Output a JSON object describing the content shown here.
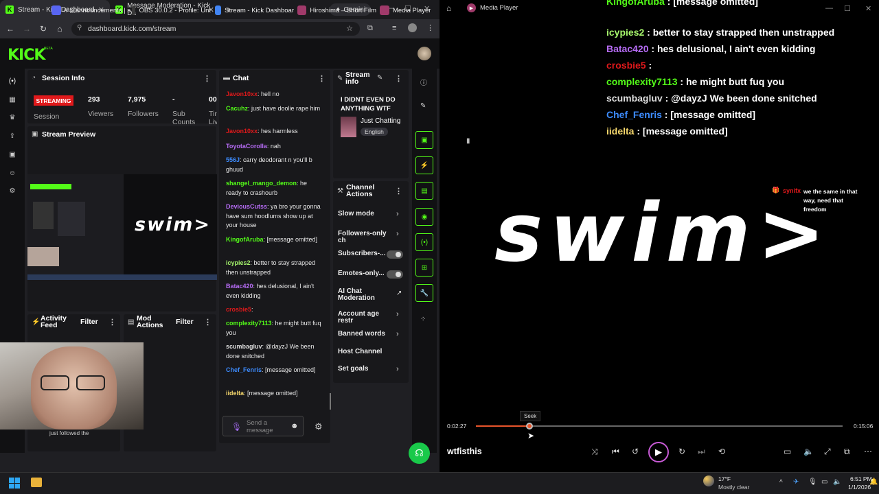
{
  "browser": {
    "tabs": [
      {
        "label": "Stream - Kick Dashboard"
      },
      {
        "label": "Message Moderation - Kick Da"
      }
    ],
    "gemini_label": "Gemini",
    "url": "dashboard.kick.com/stream"
  },
  "kick": {
    "logo": "KICK",
    "beta": "BETA",
    "session": {
      "title": "Session Info",
      "status": "STREAMING",
      "session_label": "Session",
      "viewers_value": "293",
      "viewers_label": "Viewers",
      "followers_value": "7,975",
      "followers_label": "Followers",
      "subs_value": "-",
      "subs_label": "Sub Counts",
      "fourth_value": "00",
      "fourth_label": "Tin Liv"
    },
    "preview": {
      "title": "Stream Preview",
      "overlay": "swim>"
    },
    "activity": {
      "title": "Activity Feed",
      "filter": "Filter",
      "item": "just followed the"
    },
    "mod": {
      "title": "Mod Actions",
      "filter": "Filter"
    },
    "chat": {
      "title": "Chat",
      "messages": [
        {
          "user": "Javon10xx",
          "color": "#e0191b",
          "text": ": hell no"
        },
        {
          "user": "Cacuhz",
          "color": "#53fc18",
          "text": ": just have doolie rape him"
        },
        {
          "user": "Javon10xx",
          "color": "#e0191b",
          "text": ": hes harmless"
        },
        {
          "user": "ToyotaCorolla",
          "color": "#b66cf5",
          "text": ": nah"
        },
        {
          "user": "556J",
          "color": "#3d8cff",
          "text": ": carry deodorant n you'll b ghuud"
        },
        {
          "user": "shangel_mango_demon",
          "color": "#53fc18",
          "text": ": he ready to crashourb"
        },
        {
          "user": "DeviousCutss",
          "color": "#b66cf5",
          "text": ": ya bro your gonna have sum hoodlums show up at your house"
        },
        {
          "user": "KingofAruba",
          "color": "#53fc18",
          "text": ": [message omitted]"
        },
        {
          "user": "icypies2",
          "color": "#a6f56c",
          "text": ": better to stay strapped then unstrapped"
        },
        {
          "user": "Batac420",
          "color": "#b66cf5",
          "text": ": hes delusional, I ain't even kidding"
        },
        {
          "user": "crosbie5",
          "color": "#e0191b",
          "text": ":"
        },
        {
          "user": "complexity7113",
          "color": "#53fc18",
          "text": ": he might butt fuq you"
        },
        {
          "user": "scumbagluv",
          "color": "#dddddd",
          "text": ": @dayzJ We been done snitched"
        },
        {
          "user": "Chef_Fenris",
          "color": "#3d8cff",
          "text": ": [message omitted]"
        },
        {
          "user": "iidelta",
          "color": "#f5d76c",
          "text": ": [message omitted]"
        }
      ],
      "input_placeholder": "Send a message"
    },
    "stream_info": {
      "title": "Stream info",
      "stream_title": "I DIDNT EVEN DO ANYTHING WTF",
      "category": "Just Chatting",
      "language": "English"
    },
    "channel_actions": {
      "title": "Channel Actions",
      "items": [
        {
          "label": "Slow mode",
          "kind": "chevron"
        },
        {
          "label": "Followers-only ch",
          "kind": "chevron"
        },
        {
          "label": "Subscribers-...",
          "kind": "toggle"
        },
        {
          "label": "Emotes-only...",
          "kind": "toggle"
        },
        {
          "label": "AI Chat Moderation",
          "kind": "external"
        },
        {
          "label": "Account age restr",
          "kind": "chevron"
        },
        {
          "label": "Banned words",
          "kind": "chevron"
        },
        {
          "label": "Host Channel",
          "kind": "none"
        },
        {
          "label": "Set goals",
          "kind": "chevron"
        }
      ]
    }
  },
  "media_player": {
    "title": "Media Player",
    "chat_lines": [
      {
        "user": "KingofAruba",
        "color": "#53fc18",
        "text": " : [message omitted]"
      },
      {
        "user": "icypies2",
        "color": "#a6f56c",
        "text": " : better to stay strapped then unstrapped"
      },
      {
        "user": "Batac420",
        "color": "#b66cf5",
        "text": " : hes delusional, I ain't even kidding"
      },
      {
        "user": "crosbie5",
        "color": "#e0191b",
        "text": " :"
      },
      {
        "user": "complexity7113",
        "color": "#53fc18",
        "text": " : he might butt fuq you"
      },
      {
        "user": "scumbagluv",
        "color": "#dddddd",
        "text": " : @dayzJ We been done snitched"
      },
      {
        "user": "Chef_Fenris",
        "color": "#3d8cff",
        "text": " : [message omitted]"
      },
      {
        "user": "iidelta",
        "color": "#f5d76c",
        "text": " : [message omitted]"
      }
    ],
    "alert_user": "synifx",
    "alert_text": "we the same in that way, need that freedom",
    "video_text": "swim>",
    "seek_tooltip": "Seek",
    "time_current": "0:02:27",
    "time_total": "0:15:06",
    "progress_fraction": 0.147,
    "track_title": "wtfisthis"
  },
  "taskbar": {
    "items": [
      {
        "label": "# 🇺announcements | s"
      },
      {
        "label": "OBS 30.0.2 - Profile: Unt"
      },
      {
        "label": "Stream - Kick Dashboar"
      },
      {
        "label": "Hiroshima – Short Film"
      },
      {
        "label": "Media Player"
      }
    ],
    "weather_temp": "17°F",
    "weather_desc": "Mostly clear",
    "time": "6:51 PM",
    "date": "1/1/2026"
  }
}
